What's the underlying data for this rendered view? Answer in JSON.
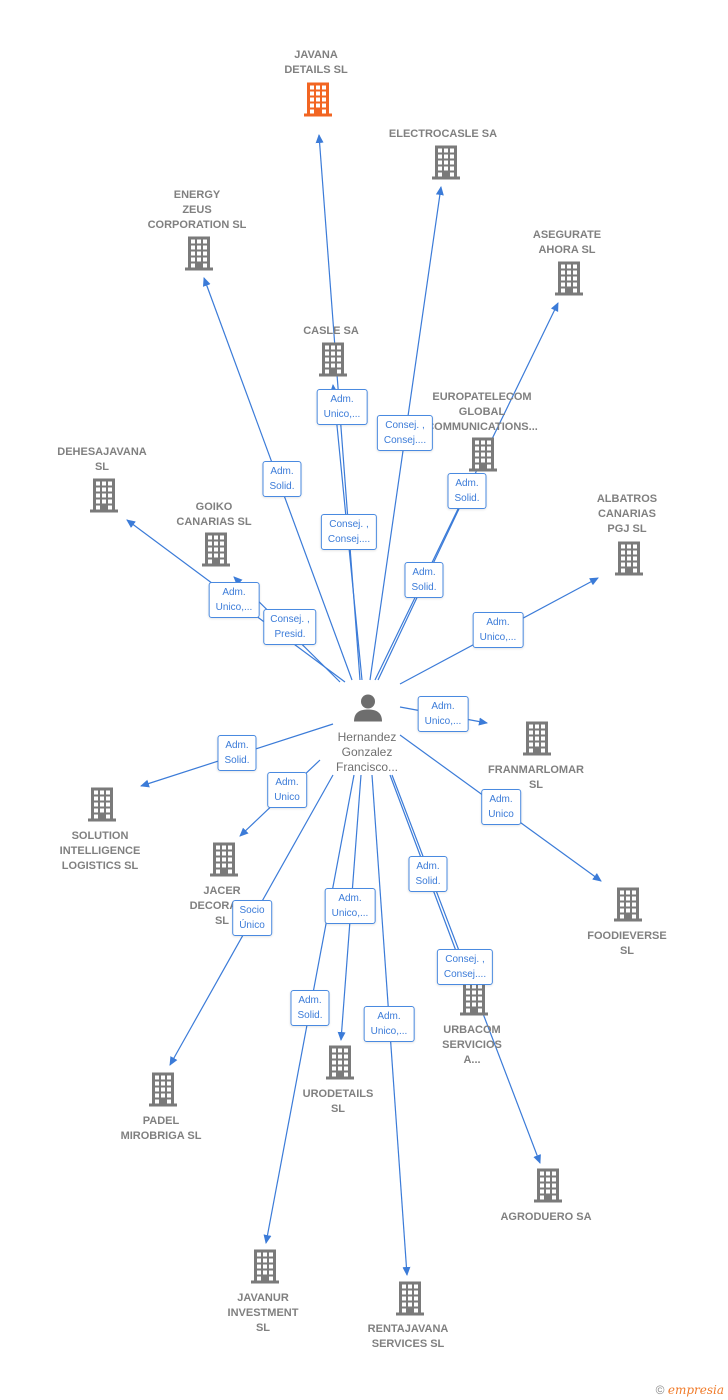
{
  "center": {
    "name": "Hernandez\nGonzalez\nFrancisco...",
    "icon": "person-icon"
  },
  "colors": {
    "edge": "#3b7bd8",
    "highlight_node": "#f26522",
    "node": "#7a7a7a"
  },
  "nodes": [
    {
      "name": "JAVANA\nDETAILS  SL",
      "highlight": true
    },
    {
      "name": "ELECTROCASLE SA"
    },
    {
      "name": "ENERGY\nZEUS\nCORPORATION SL"
    },
    {
      "name": "ASEGURATE\nAHORA SL"
    },
    {
      "name": "CASLE SA"
    },
    {
      "name": "EUROPATELECOM\nGLOBAL\nCOMMUNICATIONS..."
    },
    {
      "name": "DEHESAJAVANA\nSL"
    },
    {
      "name": "GOIKO\nCANARIAS  SL"
    },
    {
      "name": "ALBATROS\nCANARIAS\nPGJ  SL"
    },
    {
      "name": "FRANMARLOMAR\nSL"
    },
    {
      "name": "SOLUTION\nINTELLIGENCE\nLOGISTICS  SL"
    },
    {
      "name": "JACER\nDECORAC...\nSL"
    },
    {
      "name": "FOODIEVERSE\nSL"
    },
    {
      "name": "URBACOM\nSERVICIOS\nA..."
    },
    {
      "name": "PADEL\nMIROBRIGA  SL"
    },
    {
      "name": "URODETAILS\nSL"
    },
    {
      "name": "AGRODUERO SA"
    },
    {
      "name": "JAVANUR\nINVESTMENT\nSL"
    },
    {
      "name": "RENTAJAVANA\nSERVICES  SL"
    }
  ],
  "relations": [
    "Adm.\nUnico,...",
    "Consej. ,\nConsej....",
    "Adm.\nSolid.",
    "Consej. ,\nConsej....",
    "Adm.\nSolid.",
    "Adm.\nSolid.",
    "Adm.\nUnico,...",
    "Consej. ,\nPresid.",
    "Adm.\nUnico,...",
    "Adm.\nUnico,...",
    "Adm.\nSolid.",
    "Adm.\nUnico",
    "Adm.\nUnico",
    "Adm.\nSolid.",
    "Socio\nÚnico",
    "Adm.\nUnico,...",
    "Consej. ,\nConsej....",
    "Adm.\nSolid.",
    "Adm.\nUnico,..."
  ],
  "footer": {
    "copyright": "©",
    "brand": "empresia"
  }
}
